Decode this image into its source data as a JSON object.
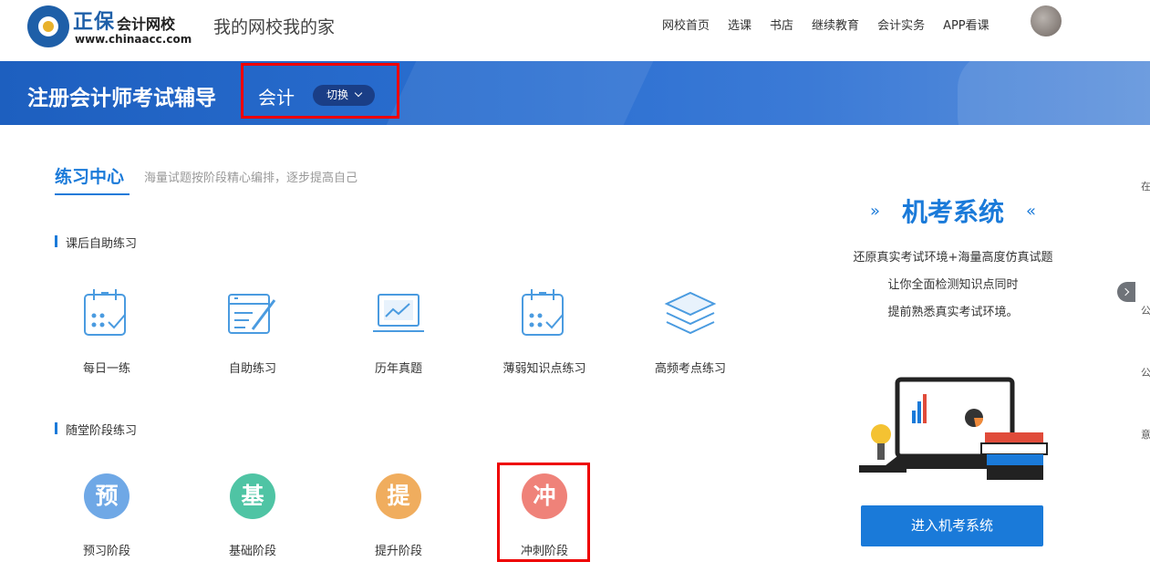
{
  "header": {
    "logo_brand": "正保",
    "logo_name": "会计网校",
    "logo_url": "www.chinaacc.com",
    "slogan": "我的网校我的家",
    "nav": [
      "网校首页",
      "选课",
      "书店",
      "继续教育",
      "会计实务",
      "APP看课"
    ]
  },
  "banner": {
    "title": "注册会计师考试辅导",
    "subject": "会计",
    "switch_label": "切换"
  },
  "practice": {
    "tab_title": "练习中心",
    "tab_subtitle": "海量试题按阶段精心编排，逐步提高自己",
    "section1_title": "课后自助练习",
    "section1_items": [
      {
        "label": "每日一练",
        "icon": "calendar-check-icon"
      },
      {
        "label": "自助练习",
        "icon": "form-pen-icon"
      },
      {
        "label": "历年真题",
        "icon": "laptop-chart-icon"
      },
      {
        "label": "薄弱知识点练习",
        "icon": "calendar-check-icon"
      },
      {
        "label": "高频考点练习",
        "icon": "layers-icon"
      }
    ],
    "section2_title": "随堂阶段练习",
    "section2_items": [
      {
        "label": "预习阶段",
        "char": "预",
        "color": "#6fa8e6"
      },
      {
        "label": "基础阶段",
        "char": "基",
        "color": "#4fc4a4"
      },
      {
        "label": "提升阶段",
        "char": "提",
        "color": "#f0ad5e"
      },
      {
        "label": "冲刺阶段",
        "char": "冲",
        "color": "#ef8279"
      }
    ]
  },
  "exam": {
    "arrow_left": "»",
    "title": "机考系统",
    "arrow_right": "«",
    "desc": [
      "还原真实考试环境+海量高度仿真试题",
      "让你全面检测知识点同时",
      "提前熟悉真实考试环境。"
    ],
    "button": "进入机考系统"
  },
  "edge_chars": [
    "在",
    "公",
    "公",
    "意"
  ],
  "colors": {
    "accent": "#1a7ad9",
    "highlight_box": "#e00000"
  }
}
